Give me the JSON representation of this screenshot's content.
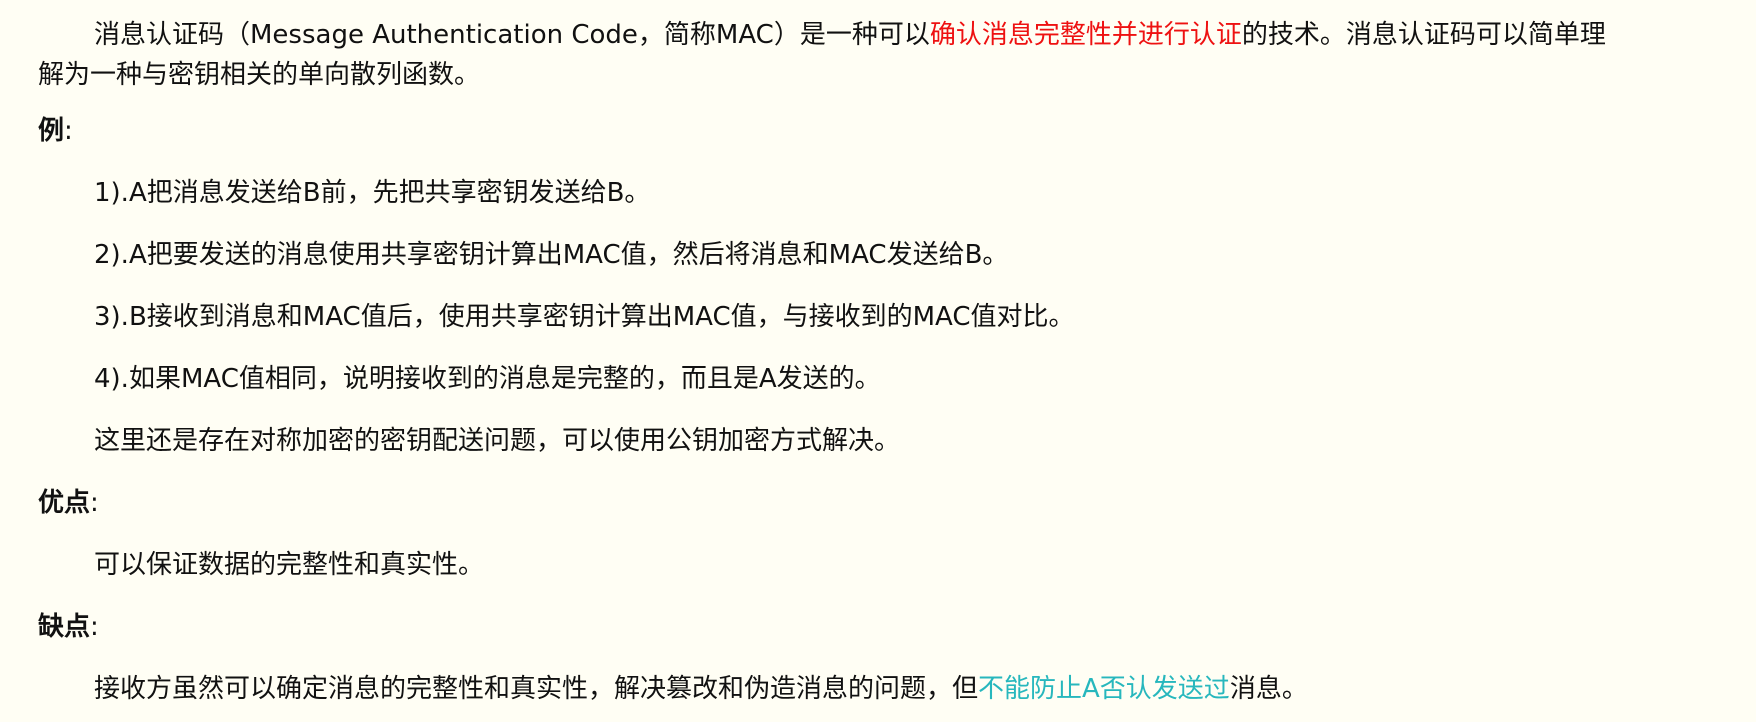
{
  "intro": {
    "part1": "消息认证码（Message Authentication Code，简称MAC）是一种可以",
    "highlight": "确认消息完整性并进行认证",
    "part2": "的技术。消息认证码可以简单理",
    "line2": "解为一种与密钥相关的单向散列函数。"
  },
  "example": {
    "heading": "例",
    "colon": ":",
    "steps": [
      "1).A把消息发送给B前，先把共享密钥发送给B。",
      "2).A把要发送的消息使用共享密钥计算出MAC值，然后将消息和MAC发送给B。",
      "3).B接收到消息和MAC值后，使用共享密钥计算出MAC值，与接收到的MAC值对比。",
      "4).如果MAC值相同，说明接收到的消息是完整的，而且是A发送的。"
    ],
    "note": "这里还是存在对称加密的密钥配送问题，可以使用公钥加密方式解决。"
  },
  "advantages": {
    "heading": "优点",
    "colon": ":",
    "text": "可以保证数据的完整性和真实性。"
  },
  "disadvantages": {
    "heading": "缺点",
    "colon": ":",
    "part1": "接收方虽然可以确定消息的完整性和真实性，解决篡改和伪造消息的问题，但",
    "highlight": "不能防止A否认发送过",
    "part2": "消息。"
  },
  "colors": {
    "background": "#fffef4",
    "text": "#111111",
    "highlight_red": "#ee1111",
    "highlight_teal": "#27b7bd"
  }
}
